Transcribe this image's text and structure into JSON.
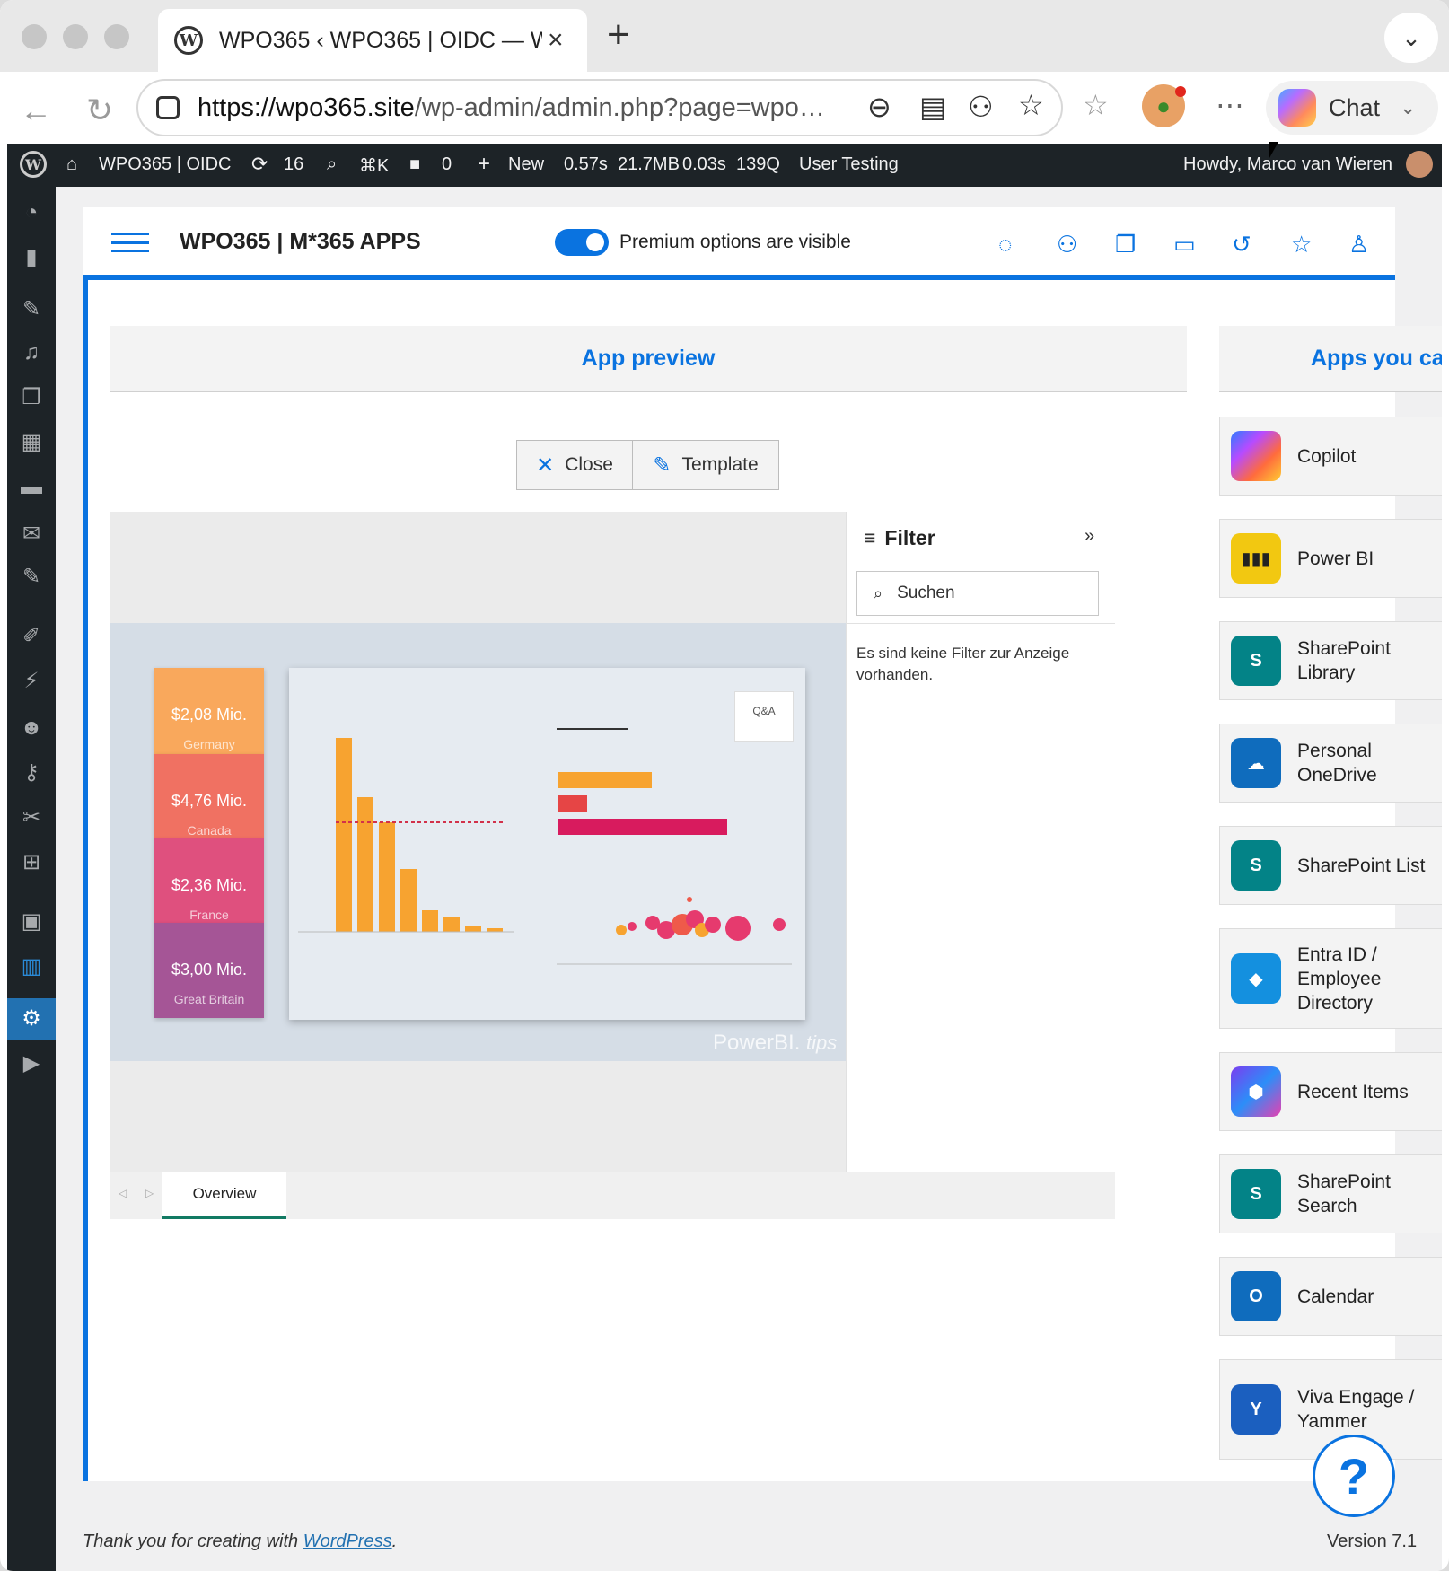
{
  "browser": {
    "tab_title": "WPO365 ‹ WPO365 | OIDC — W",
    "url_domain": "https://wpo365.site",
    "url_path": "/wp-admin/admin.php?page=wpo…",
    "chat_label": "Chat"
  },
  "adminbar": {
    "site": "WPO365 | OIDC",
    "updates": "16",
    "shortcut": "⌘K",
    "comments": "0",
    "new": "New",
    "perf": "0.57s",
    "mem": "21.7MB",
    "qtime": "0.03s",
    "queries": "139Q",
    "env": "User Testing",
    "howdy": "Howdy, Marco van Wieren"
  },
  "plugin": {
    "title": "WPO365 | M*365 APPS",
    "toggle_label": "Premium options are visible",
    "toggle_on": true,
    "accent": "#0a73e0"
  },
  "preview": {
    "header": "App preview",
    "close_label": "Close",
    "template_label": "Template",
    "kpis": [
      {
        "value": "$2,08 Mio.",
        "country": "Germany",
        "color": "#f9a85c"
      },
      {
        "value": "$4,76 Mio.",
        "country": "Canada",
        "color": "#f07162"
      },
      {
        "value": "$2,36 Mio.",
        "country": "France",
        "color": "#df507e"
      },
      {
        "value": "$3,00 Mio.",
        "country": "Great Britain",
        "color": "#a55596"
      }
    ],
    "qa_label": "Q&A",
    "brand": "PowerBI.",
    "brand_suffix": "tips",
    "filter_title": "Filter",
    "filter_placeholder": "Suchen",
    "filter_empty": "Es sind keine Filter zur Anzeige vorhanden.",
    "page_tab": "Overview"
  },
  "apps": {
    "header": "Apps you ca",
    "items": [
      {
        "label": "Copilot",
        "icon": "copilot-icon"
      },
      {
        "label": "Power BI",
        "icon": "powerbi-icon"
      },
      {
        "label": "SharePoint Library",
        "icon": "sharepoint-icon"
      },
      {
        "label": "Personal OneDrive",
        "icon": "onedrive-icon"
      },
      {
        "label": "SharePoint List",
        "icon": "sharepoint-icon"
      },
      {
        "label": "Entra ID / Employee Directory",
        "icon": "entra-icon"
      },
      {
        "label": "Recent Items",
        "icon": "m365-icon"
      },
      {
        "label": "SharePoint Search",
        "icon": "sharepoint-icon"
      },
      {
        "label": "Calendar",
        "icon": "outlook-icon"
      },
      {
        "label": "Viva Engage / Yammer",
        "icon": "yammer-icon"
      }
    ]
  },
  "footer": {
    "thanks": "Thank you for creating with",
    "link": "WordPress",
    "version": "Version 7.1"
  }
}
